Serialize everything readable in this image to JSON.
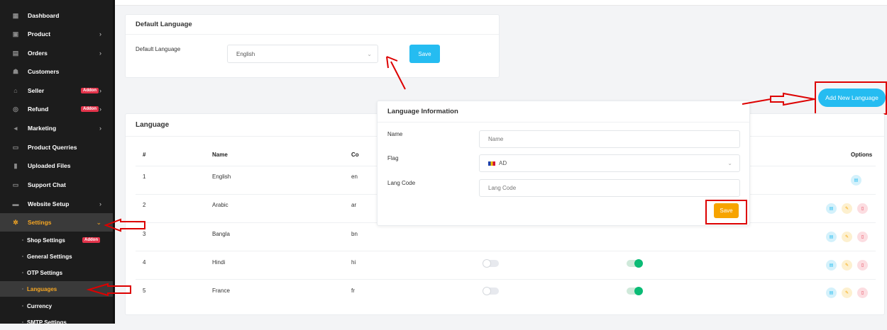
{
  "sidebar": {
    "items": [
      {
        "label": "Dashboard",
        "icon": "dashboard-icon",
        "chevron": false,
        "badge": ""
      },
      {
        "label": "Product",
        "icon": "product-icon",
        "chevron": true,
        "badge": ""
      },
      {
        "label": "Orders",
        "icon": "orders-icon",
        "chevron": true,
        "badge": ""
      },
      {
        "label": "Customers",
        "icon": "customers-icon",
        "chevron": false,
        "badge": ""
      },
      {
        "label": "Seller",
        "icon": "seller-icon",
        "chevron": true,
        "badge": "Addon"
      },
      {
        "label": "Refund",
        "icon": "refund-icon",
        "chevron": true,
        "badge": "Addon"
      },
      {
        "label": "Marketing",
        "icon": "marketing-icon",
        "chevron": true,
        "badge": ""
      },
      {
        "label": "Product Querries",
        "icon": "chat-icon",
        "chevron": false,
        "badge": ""
      },
      {
        "label": "Uploaded Files",
        "icon": "files-icon",
        "chevron": false,
        "badge": ""
      },
      {
        "label": "Support Chat",
        "icon": "chat-icon",
        "chevron": false,
        "badge": ""
      },
      {
        "label": "Website Setup",
        "icon": "website-icon",
        "chevron": true,
        "badge": ""
      },
      {
        "label": "Settings",
        "icon": "gear-icon",
        "chevron": true,
        "badge": ""
      }
    ],
    "sub_items": [
      {
        "label": "Shop Settings",
        "badge": "Addon"
      },
      {
        "label": "General Settings",
        "badge": ""
      },
      {
        "label": "OTP Settings",
        "badge": ""
      },
      {
        "label": "Languages",
        "badge": ""
      },
      {
        "label": "Currency",
        "badge": ""
      },
      {
        "label": "SMTP Settings",
        "badge": ""
      }
    ]
  },
  "default_language": {
    "title": "Default Language",
    "field_label": "Default Language",
    "selected": "English",
    "save_label": "Save"
  },
  "add_button": "Add New Language",
  "language_table": {
    "title": "Language",
    "headers": {
      "num": "#",
      "name": "Name",
      "code": "Co",
      "options": "Options"
    },
    "rows": [
      {
        "num": "1",
        "name": "English",
        "code": "en"
      },
      {
        "num": "2",
        "name": "Arabic",
        "code": "ar"
      },
      {
        "num": "3",
        "name": "Bangla",
        "code": "bn"
      },
      {
        "num": "4",
        "name": "Hindi",
        "code": "hi"
      },
      {
        "num": "5",
        "name": "France",
        "code": "fr"
      }
    ]
  },
  "language_info": {
    "title": "Language Information",
    "name_label": "Name",
    "name_placeholder": "Name",
    "flag_label": "Flag",
    "flag_value": "AD",
    "code_label": "Lang Code",
    "code_placeholder": "Lang Code",
    "save_label": "Save"
  },
  "colors": {
    "accent_blue": "#25bcf1",
    "accent_orange": "#f7a400",
    "annotation_red": "#dd0000",
    "toggle_green": "#0abb75"
  }
}
